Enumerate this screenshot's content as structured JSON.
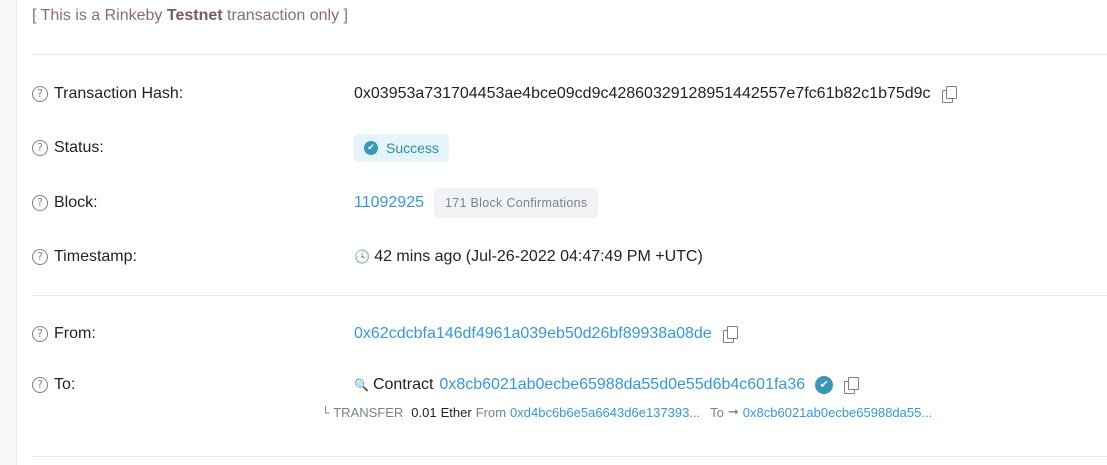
{
  "banner": {
    "prefix": "[ This is a Rinkeby ",
    "strong": "Testnet",
    "suffix": " transaction only ]"
  },
  "labels": {
    "tx_hash": "Transaction Hash:",
    "status": "Status:",
    "block": "Block:",
    "timestamp": "Timestamp:",
    "from": "From:",
    "to": "To:"
  },
  "help_glyph": "?",
  "tx_hash": "0x03953a731704453ae4bce09cd9c42860329128951442557e7fc61b82c1b75d9c",
  "status": "Success",
  "block": {
    "number": "11092925",
    "confirmations": "171 Block Confirmations"
  },
  "timestamp": "42 mins ago (Jul-26-2022 04:47:49 PM +UTC)",
  "from_address": "0x62cdcbfa146df4961a039eb50d26bf89938a08de",
  "to": {
    "prefix": "Contract",
    "address": "0x8cb6021ab0ecbe65988da55d0e55d6b4c601fa36"
  },
  "transfer": {
    "label": "TRANSFER",
    "amount": "0.01",
    "unit": "Ether",
    "from_label": "From",
    "from_address": "0xd4bc6b6e5a6643d6e137393...",
    "to_label": "To",
    "to_address": "0x8cb6021ab0ecbe65988da55..."
  },
  "icons": {
    "help": "help-circle-icon",
    "copy": "copy-icon",
    "success": "check-circle-icon",
    "clock": "clock-icon",
    "contract": "zoom-in-icon",
    "verified": "verified-check-icon"
  }
}
